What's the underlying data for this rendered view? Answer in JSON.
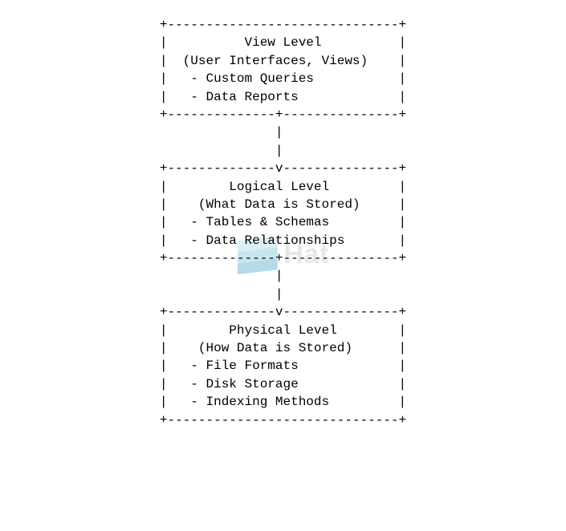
{
  "diagram": {
    "box1": {
      "border_top": "+------------------------------+",
      "title": "|          View Level          |",
      "subtitle": "|  (User Interfaces, Views)    |",
      "item1": "|   - Custom Queries           |",
      "item2": "|   - Data Reports             |",
      "border_bot": "+--------------+---------------+"
    },
    "arrow1": {
      "l1": "               |                ",
      "l2": "               |                "
    },
    "box2": {
      "border_top": "+--------------v---------------+",
      "title": "|        Logical Level         |",
      "subtitle": "|    (What Data is Stored)     |",
      "item1": "|   - Tables & Schemas         |",
      "item2": "|   - Data Relationships       |",
      "border_bot": "+--------------+---------------+"
    },
    "arrow2": {
      "l1": "               |                ",
      "l2": "               |                "
    },
    "box3": {
      "border_top": "+--------------v---------------+",
      "title": "|        Physical Level        |",
      "subtitle": "|    (How Data is Stored)      |",
      "item1": "|   - File Formats             |",
      "item2": "|   - Disk Storage             |",
      "item3": "|   - Indexing Methods         |",
      "border_bot": "+------------------------------+"
    }
  },
  "watermark": {
    "text": "Hat"
  }
}
